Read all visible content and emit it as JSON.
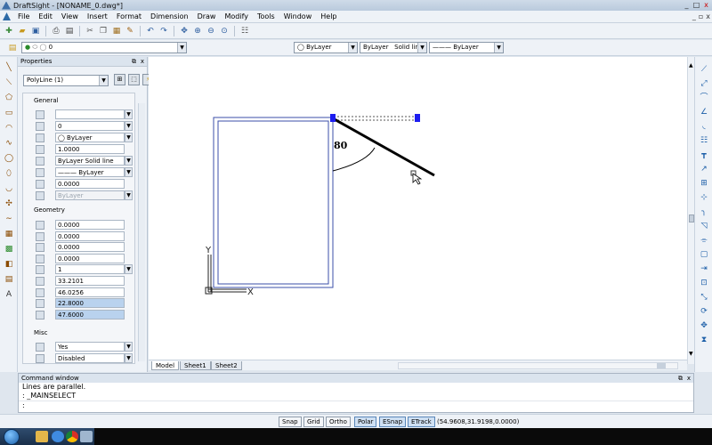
{
  "window": {
    "title": "DraftSight - [NONAME_0.dwg*]",
    "controls": [
      "_",
      "□",
      "x"
    ]
  },
  "menu": [
    "File",
    "Edit",
    "View",
    "Insert",
    "Format",
    "Dimension",
    "Draw",
    "Modify",
    "Tools",
    "Window",
    "Help"
  ],
  "toolbar": {
    "layer_value": "0",
    "color_value": "ByLayer",
    "linestyle_value": "ByLayer",
    "linestyle_name": "Solid line",
    "lineweight_value": "ByLayer"
  },
  "properties": {
    "title": "Properties",
    "selection": "PolyLine (1)",
    "general_title": "General",
    "general": [
      {
        "icon": "color-wheel-icon",
        "value": "",
        "dropdown": true
      },
      {
        "icon": "layer-icon",
        "value": "0",
        "dropdown": true
      },
      {
        "icon": "color-icon",
        "value": "◯ ByLayer",
        "dropdown": true
      },
      {
        "icon": "linescale-icon",
        "value": "1.0000",
        "dropdown": false
      },
      {
        "icon": "linestyle-icon",
        "value": "ByLayer     Solid line",
        "dropdown": true
      },
      {
        "icon": "lineweight-icon",
        "value": "——— ByLayer",
        "dropdown": true
      },
      {
        "icon": "thickness-icon",
        "value": "0.0000",
        "dropdown": false
      },
      {
        "icon": "transparency-icon",
        "value": "ByLayer",
        "dropdown": true,
        "disabled": true
      }
    ],
    "geometry_title": "Geometry",
    "geometry": [
      {
        "icon": "elevation-icon",
        "value": "0.0000",
        "dropdown": false
      },
      {
        "icon": "start-width-icon",
        "value": "0.0000",
        "dropdown": false
      },
      {
        "icon": "end-width-icon",
        "value": "0.0000",
        "dropdown": false
      },
      {
        "icon": "global-width-icon",
        "value": "0.0000",
        "dropdown": false
      },
      {
        "icon": "vertex-icon",
        "value": "1",
        "dropdown": true
      },
      {
        "icon": "vertex-x-icon",
        "value": "33.2101",
        "dropdown": false
      },
      {
        "icon": "vertex-y-icon",
        "value": "46.0256",
        "dropdown": false
      },
      {
        "icon": "area-icon",
        "value": "22.8000",
        "dropdown": false,
        "highlight": true
      },
      {
        "icon": "length-icon",
        "value": "47.6000",
        "dropdown": false,
        "highlight": true
      }
    ],
    "misc_title": "Misc",
    "misc": [
      {
        "icon": "closed-icon",
        "value": "Yes",
        "dropdown": true
      },
      {
        "icon": "linetype-gen-icon",
        "value": "Disabled",
        "dropdown": true
      }
    ]
  },
  "drawing": {
    "angle_label": "80",
    "y_axis_label": "Y",
    "x_axis_label": "X"
  },
  "sheets": [
    "Model",
    "Sheet1",
    "Sheet2"
  ],
  "command": {
    "title": "Command window",
    "lines": [
      "Lines are parallel.",
      ": _MAINSELECT",
      ":"
    ]
  },
  "status": {
    "buttons": [
      {
        "label": "Snap",
        "on": false
      },
      {
        "label": "Grid",
        "on": false
      },
      {
        "label": "Ortho",
        "on": false
      },
      {
        "label": "Polar",
        "on": true
      },
      {
        "label": "ESnap",
        "on": true
      },
      {
        "label": "ETrack",
        "on": true
      }
    ],
    "coords": "(54.9608,31.9198,0.0000)"
  }
}
